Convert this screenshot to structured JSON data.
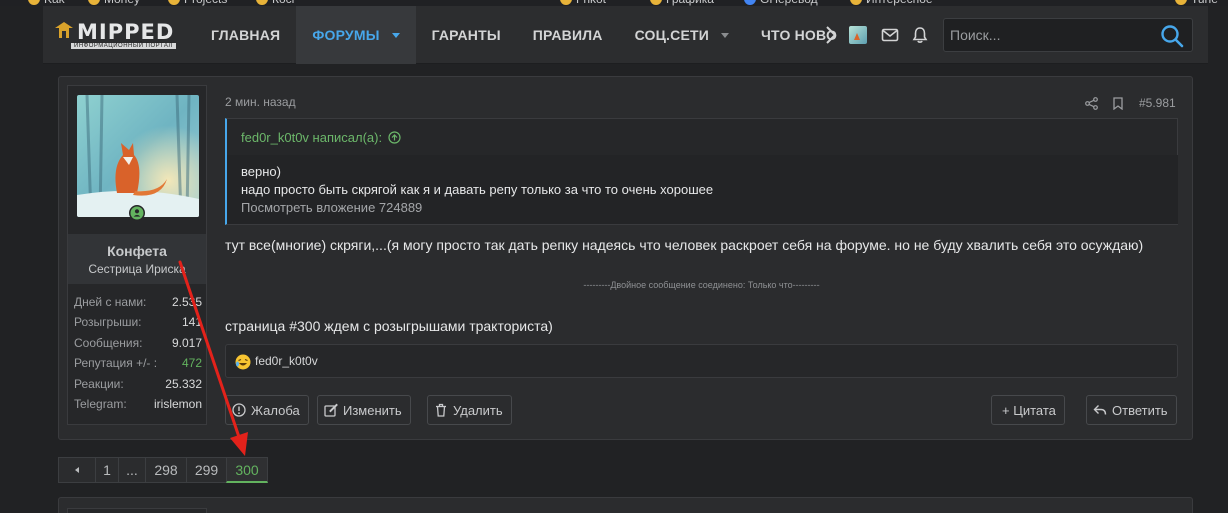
{
  "bookmarks": [
    {
      "label": "Kak",
      "icon": "folder-icon",
      "color": "#e8b339"
    },
    {
      "label": "Money",
      "icon": "folder-icon",
      "color": "#e8b339"
    },
    {
      "label": "Projects",
      "icon": "folder-icon",
      "color": "#e8b339"
    },
    {
      "label": "Косr",
      "icon": "folder-icon",
      "color": "#e8b339"
    },
    {
      "label": "Fnkot",
      "icon": "folder-icon",
      "color": "#e8b339"
    },
    {
      "label": "Графика",
      "icon": "folder-icon",
      "color": "#e8b339"
    },
    {
      "label": "GНеревод",
      "icon": "translate-icon",
      "color": "#4285f4"
    },
    {
      "label": "Интересное",
      "icon": "folder-icon",
      "color": "#e8b339"
    },
    {
      "label": "Tune",
      "icon": "folder-icon",
      "color": "#e8b339"
    }
  ],
  "site": {
    "logo_name": "MIPPED",
    "logo_sub": "ИНФОРМАЦИОННЫЙ ПОРТАЛ",
    "accent": "#47a7eb",
    "positive": "#63b35f"
  },
  "nav": {
    "items": [
      {
        "label": "ГЛАВНАЯ",
        "caret": false,
        "active": false
      },
      {
        "label": "ФОРУМЫ",
        "caret": true,
        "active": true
      },
      {
        "label": "ГАРАНТЫ",
        "caret": false,
        "active": false
      },
      {
        "label": "ПРАВИЛА",
        "caret": false,
        "active": false
      },
      {
        "label": "СОЦ.СЕТИ",
        "caret": true,
        "active": false
      },
      {
        "label": "ЧТО НОВО",
        "caret": false,
        "active": false
      }
    ]
  },
  "search": {
    "placeholder": "Поиск..."
  },
  "user": {
    "name": "Конфета",
    "title": "Сестрица Ириска",
    "stats": [
      {
        "label": "Дней с нами:",
        "value": "2.535"
      },
      {
        "label": "Розыгрыши:",
        "value": "141"
      },
      {
        "label": "Сообщения:",
        "value": "9.017"
      },
      {
        "label": "Репутация +/- :",
        "value": "472"
      },
      {
        "label": "Реакции:",
        "value": "25.332"
      },
      {
        "label": "Telegram:",
        "value": "irislemon"
      }
    ]
  },
  "post": {
    "time": "2 мин. назад",
    "number": "#5.981",
    "quote": {
      "author": "fed0r_k0t0v написал(а):",
      "lines": [
        "верно)",
        "надо просто быть скрягой как я и давать репу только за что то очень хорошее"
      ],
      "attachment": "Посмотреть вложение 724889"
    },
    "text1": "тут все(многие) скряги,...(я могу просто так дать репку надеясь что человек раскроет себя на форуме. но не буду хвалить себя это осуждаю)",
    "merged_note": "---------Двойное сообщение соединено: Только что---------",
    "text2": "страница #300 ждем с розыгрышами тракториста)",
    "reaction_user": "fed0r_k0t0v",
    "actions": {
      "report": "Жалоба",
      "edit": "Изменить",
      "delete": "Удалить",
      "quote": "+ Цитата",
      "reply": "Ответить"
    }
  },
  "pagination": {
    "pages": [
      "1",
      "...",
      "298",
      "299",
      "300"
    ],
    "current": "300"
  }
}
